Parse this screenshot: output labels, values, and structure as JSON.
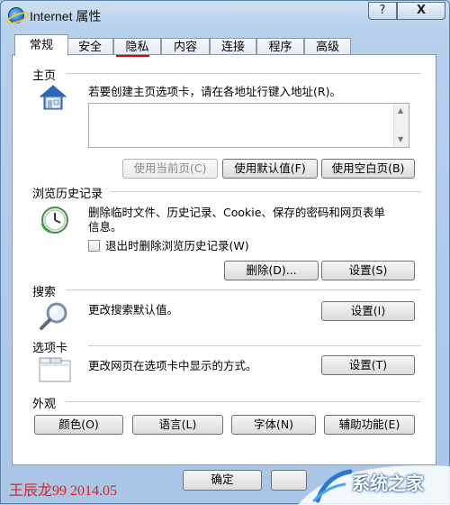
{
  "window": {
    "title": "Internet 属性",
    "help_label": "?",
    "close_label": "X"
  },
  "tabs": [
    {
      "label": "常规"
    },
    {
      "label": "安全"
    },
    {
      "label": "隐私"
    },
    {
      "label": "内容"
    },
    {
      "label": "连接"
    },
    {
      "label": "程序"
    },
    {
      "label": "高级"
    }
  ],
  "active_tab": "常规",
  "homepage": {
    "title": "主页",
    "instruction": "若要创建主页选项卡，请在各地址行键入地址(R)。",
    "url_value": "",
    "use_current_label": "使用当前页(C)",
    "use_default_label": "使用默认值(F)",
    "use_blank_label": "使用空白页(B)"
  },
  "history": {
    "title": "浏览历史记录",
    "description_line1": "删除临时文件、历史记录、Cookie、保存的密码和网页表单",
    "description_line2": "信息。",
    "checkbox_label": "退出时删除浏览历史记录(W)",
    "checkbox_checked": false,
    "delete_label": "删除(D)...",
    "settings_label": "设置(S)"
  },
  "search": {
    "title": "搜索",
    "description": "更改搜索默认值。",
    "settings_label": "设置(I)"
  },
  "tabs_section": {
    "title": "选项卡",
    "description": "更改网页在选项卡中显示的方式。",
    "settings_label": "设置(T)"
  },
  "appearance": {
    "title": "外观",
    "colors_label": "颜色(O)",
    "languages_label": "语言(L)",
    "fonts_label": "字体(N)",
    "accessibility_label": "辅助功能(E)"
  },
  "footer": {
    "ok_label": "确定",
    "watermark": "王辰龙99 2014.05",
    "logo_text": "系统之家"
  },
  "colors": {
    "accent_underline": "#e00000",
    "watermark": "#e02020"
  }
}
